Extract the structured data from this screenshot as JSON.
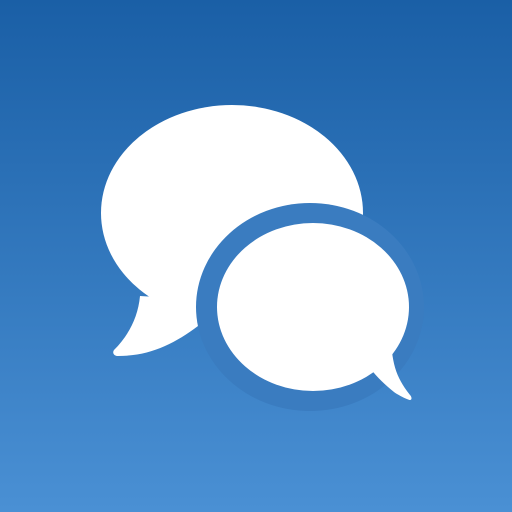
{
  "icon": {
    "name": "chat-bubbles-icon",
    "background_top": "#1a5fa6",
    "background_bottom": "#4a90d4",
    "bubble_color": "#ffffff"
  }
}
